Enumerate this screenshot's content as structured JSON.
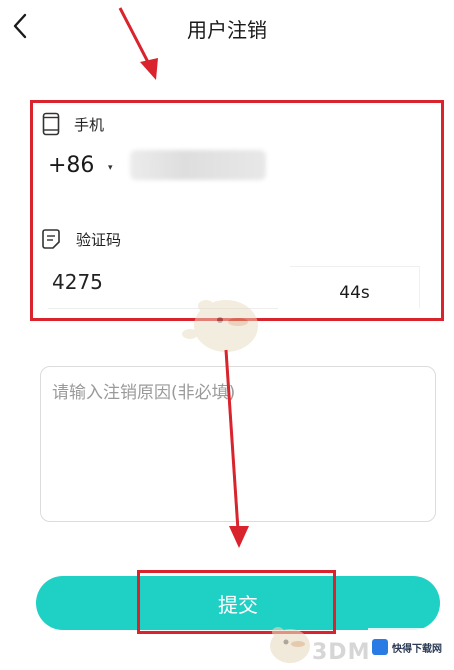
{
  "header": {
    "title": "用户注销"
  },
  "phone_field": {
    "label": "手机",
    "country_code": "+86",
    "caret": "▾"
  },
  "code_field": {
    "label": "验证码",
    "value": "4275",
    "countdown": "44s"
  },
  "reason_field": {
    "placeholder": "请输入注销原因(非必填)",
    "value": ""
  },
  "submit": {
    "label": "提交"
  },
  "watermark": {
    "text": "3DM",
    "badge_text": "快得下载网"
  },
  "colors": {
    "accent": "#1fd0c4",
    "annotation_red": "#d9232d"
  }
}
